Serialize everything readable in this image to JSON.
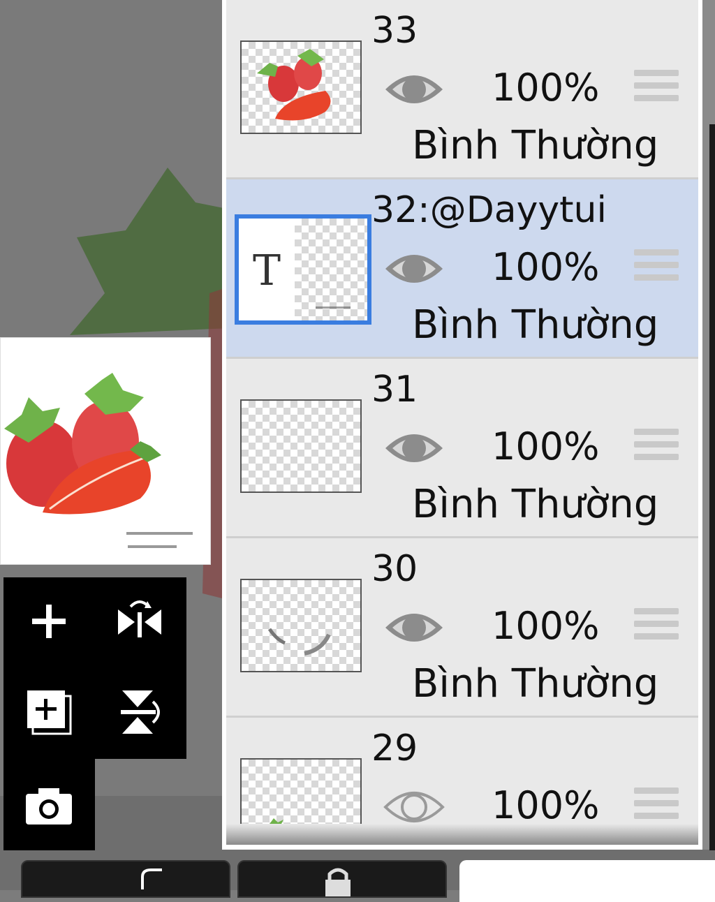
{
  "layers": [
    {
      "name": "33",
      "opacity": "100%",
      "blend": "Bình Thường",
      "visible": true,
      "selected": false
    },
    {
      "name": "32:@Dayytui",
      "opacity": "100%",
      "blend": "Bình Thường",
      "visible": true,
      "selected": true
    },
    {
      "name": "31",
      "opacity": "100%",
      "blend": "Bình Thường",
      "visible": true,
      "selected": false
    },
    {
      "name": "30",
      "opacity": "100%",
      "blend": "Bình Thường",
      "visible": true,
      "selected": false
    },
    {
      "name": "29",
      "opacity": "100%",
      "blend": "",
      "visible": false,
      "selected": false
    }
  ],
  "text_layer_glyph": "T",
  "colors": {
    "selection": "#3a7de0",
    "selected_row": "#cdd9ee",
    "panel": "#e9e9e9"
  },
  "icons": [
    "add-layer-icon",
    "flip-horizontal-icon",
    "duplicate-layer-icon",
    "flip-vertical-icon",
    "camera-icon",
    "eye-icon",
    "drag-handle-icon"
  ]
}
